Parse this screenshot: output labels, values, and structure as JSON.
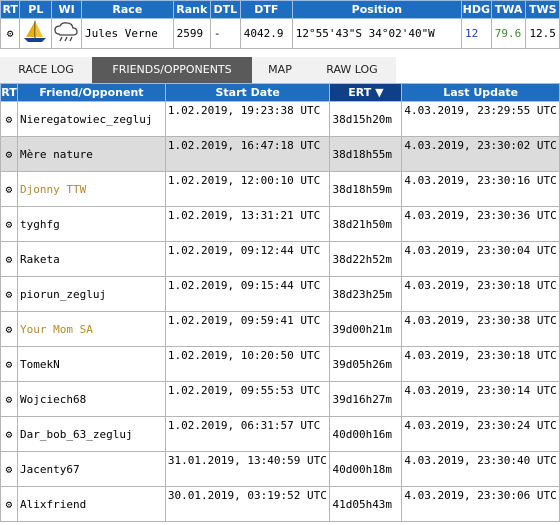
{
  "race_table": {
    "headers": [
      "RT",
      "PL",
      "WI",
      "Race",
      "Rank",
      "DTL",
      "DTF",
      "Position",
      "HDG",
      "TWA",
      "TWS"
    ],
    "row": {
      "race": "Jules Verne",
      "rank": "2599",
      "dtl": "-",
      "dtf": "4042.9",
      "position": "12°55'43\"S 34°02'40\"W",
      "hdg": "12",
      "twa": "79.6",
      "tws": "12.5"
    }
  },
  "tabs": [
    {
      "label": "RACE LOG"
    },
    {
      "label": "FRIENDS/OPPONENTS"
    },
    {
      "label": "MAP"
    },
    {
      "label": "RAW LOG"
    }
  ],
  "friends_table": {
    "headers": {
      "rt": "RT",
      "name": "Friend/Opponent",
      "start": "Start Date",
      "ert": "ERT ▼",
      "last": "Last Update"
    },
    "rows": [
      {
        "name": "Nieregatowiec_zegluj",
        "start": "1.02.2019, 19:23:38 UTC",
        "ert": "38d15h20m",
        "last": "4.03.2019, 23:29:55 UTC"
      },
      {
        "name": "Mère nature",
        "start": "1.02.2019, 16:47:18 UTC",
        "ert": "38d18h55m",
        "last": "4.03.2019, 23:30:02 UTC"
      },
      {
        "name": "Djonny TTW",
        "start": "1.02.2019, 12:00:10 UTC",
        "ert": "38d18h59m",
        "last": "4.03.2019, 23:30:16 UTC"
      },
      {
        "name": "tyghfg",
        "start": "1.02.2019, 13:31:21 UTC",
        "ert": "38d21h50m",
        "last": "4.03.2019, 23:30:36 UTC"
      },
      {
        "name": "Raketa",
        "start": "1.02.2019, 09:12:44 UTC",
        "ert": "38d22h52m",
        "last": "4.03.2019, 23:30:04 UTC"
      },
      {
        "name": "piorun_zegluj",
        "start": "1.02.2019, 09:15:44 UTC",
        "ert": "38d23h25m",
        "last": "4.03.2019, 23:30:18 UTC"
      },
      {
        "name": "Your Mom SA",
        "start": "1.02.2019, 09:59:41 UTC",
        "ert": "39d00h21m",
        "last": "4.03.2019, 23:30:38 UTC"
      },
      {
        "name": "TomekN",
        "start": "1.02.2019, 10:20:50 UTC",
        "ert": "39d05h26m",
        "last": "4.03.2019, 23:30:18 UTC"
      },
      {
        "name": "Wojciech68",
        "start": "1.02.2019, 09:55:53 UTC",
        "ert": "39d16h27m",
        "last": "4.03.2019, 23:30:14 UTC"
      },
      {
        "name": "Dar_bob_63_zegluj",
        "start": "1.02.2019, 06:31:57 UTC",
        "ert": "40d00h16m",
        "last": "4.03.2019, 23:30:24 UTC"
      },
      {
        "name": "Jacenty67",
        "start": "31.01.2019, 13:40:59 UTC",
        "ert": "40d00h18m",
        "last": "4.03.2019, 23:30:40 UTC"
      },
      {
        "name": "Alixfriend",
        "start": "30.01.2019, 03:19:52 UTC",
        "ert": "41d05h43m",
        "last": "4.03.2019, 23:30:06 UTC"
      }
    ]
  },
  "colors": {
    "header_blue": "#1f6dc1",
    "sorted_header": "#103f8a",
    "active_tab": "#5a5a5a",
    "gold_name": "#b58a2c",
    "selected_row": "#dcdcdc"
  }
}
